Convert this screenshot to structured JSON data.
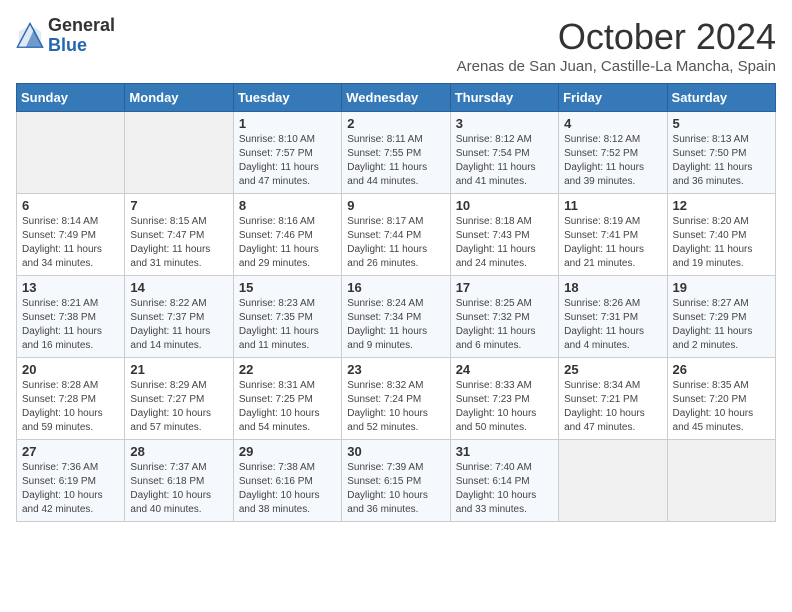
{
  "header": {
    "logo": {
      "general": "General",
      "blue": "Blue"
    },
    "title": "October 2024",
    "subtitle": "Arenas de San Juan, Castille-La Mancha, Spain"
  },
  "weekdays": [
    "Sunday",
    "Monday",
    "Tuesday",
    "Wednesday",
    "Thursday",
    "Friday",
    "Saturday"
  ],
  "weeks": [
    [
      {
        "day": "",
        "info": ""
      },
      {
        "day": "",
        "info": ""
      },
      {
        "day": "1",
        "info": "Sunrise: 8:10 AM\nSunset: 7:57 PM\nDaylight: 11 hours and 47 minutes."
      },
      {
        "day": "2",
        "info": "Sunrise: 8:11 AM\nSunset: 7:55 PM\nDaylight: 11 hours and 44 minutes."
      },
      {
        "day": "3",
        "info": "Sunrise: 8:12 AM\nSunset: 7:54 PM\nDaylight: 11 hours and 41 minutes."
      },
      {
        "day": "4",
        "info": "Sunrise: 8:12 AM\nSunset: 7:52 PM\nDaylight: 11 hours and 39 minutes."
      },
      {
        "day": "5",
        "info": "Sunrise: 8:13 AM\nSunset: 7:50 PM\nDaylight: 11 hours and 36 minutes."
      }
    ],
    [
      {
        "day": "6",
        "info": "Sunrise: 8:14 AM\nSunset: 7:49 PM\nDaylight: 11 hours and 34 minutes."
      },
      {
        "day": "7",
        "info": "Sunrise: 8:15 AM\nSunset: 7:47 PM\nDaylight: 11 hours and 31 minutes."
      },
      {
        "day": "8",
        "info": "Sunrise: 8:16 AM\nSunset: 7:46 PM\nDaylight: 11 hours and 29 minutes."
      },
      {
        "day": "9",
        "info": "Sunrise: 8:17 AM\nSunset: 7:44 PM\nDaylight: 11 hours and 26 minutes."
      },
      {
        "day": "10",
        "info": "Sunrise: 8:18 AM\nSunset: 7:43 PM\nDaylight: 11 hours and 24 minutes."
      },
      {
        "day": "11",
        "info": "Sunrise: 8:19 AM\nSunset: 7:41 PM\nDaylight: 11 hours and 21 minutes."
      },
      {
        "day": "12",
        "info": "Sunrise: 8:20 AM\nSunset: 7:40 PM\nDaylight: 11 hours and 19 minutes."
      }
    ],
    [
      {
        "day": "13",
        "info": "Sunrise: 8:21 AM\nSunset: 7:38 PM\nDaylight: 11 hours and 16 minutes."
      },
      {
        "day": "14",
        "info": "Sunrise: 8:22 AM\nSunset: 7:37 PM\nDaylight: 11 hours and 14 minutes."
      },
      {
        "day": "15",
        "info": "Sunrise: 8:23 AM\nSunset: 7:35 PM\nDaylight: 11 hours and 11 minutes."
      },
      {
        "day": "16",
        "info": "Sunrise: 8:24 AM\nSunset: 7:34 PM\nDaylight: 11 hours and 9 minutes."
      },
      {
        "day": "17",
        "info": "Sunrise: 8:25 AM\nSunset: 7:32 PM\nDaylight: 11 hours and 6 minutes."
      },
      {
        "day": "18",
        "info": "Sunrise: 8:26 AM\nSunset: 7:31 PM\nDaylight: 11 hours and 4 minutes."
      },
      {
        "day": "19",
        "info": "Sunrise: 8:27 AM\nSunset: 7:29 PM\nDaylight: 11 hours and 2 minutes."
      }
    ],
    [
      {
        "day": "20",
        "info": "Sunrise: 8:28 AM\nSunset: 7:28 PM\nDaylight: 10 hours and 59 minutes."
      },
      {
        "day": "21",
        "info": "Sunrise: 8:29 AM\nSunset: 7:27 PM\nDaylight: 10 hours and 57 minutes."
      },
      {
        "day": "22",
        "info": "Sunrise: 8:31 AM\nSunset: 7:25 PM\nDaylight: 10 hours and 54 minutes."
      },
      {
        "day": "23",
        "info": "Sunrise: 8:32 AM\nSunset: 7:24 PM\nDaylight: 10 hours and 52 minutes."
      },
      {
        "day": "24",
        "info": "Sunrise: 8:33 AM\nSunset: 7:23 PM\nDaylight: 10 hours and 50 minutes."
      },
      {
        "day": "25",
        "info": "Sunrise: 8:34 AM\nSunset: 7:21 PM\nDaylight: 10 hours and 47 minutes."
      },
      {
        "day": "26",
        "info": "Sunrise: 8:35 AM\nSunset: 7:20 PM\nDaylight: 10 hours and 45 minutes."
      }
    ],
    [
      {
        "day": "27",
        "info": "Sunrise: 7:36 AM\nSunset: 6:19 PM\nDaylight: 10 hours and 42 minutes."
      },
      {
        "day": "28",
        "info": "Sunrise: 7:37 AM\nSunset: 6:18 PM\nDaylight: 10 hours and 40 minutes."
      },
      {
        "day": "29",
        "info": "Sunrise: 7:38 AM\nSunset: 6:16 PM\nDaylight: 10 hours and 38 minutes."
      },
      {
        "day": "30",
        "info": "Sunrise: 7:39 AM\nSunset: 6:15 PM\nDaylight: 10 hours and 36 minutes."
      },
      {
        "day": "31",
        "info": "Sunrise: 7:40 AM\nSunset: 6:14 PM\nDaylight: 10 hours and 33 minutes."
      },
      {
        "day": "",
        "info": ""
      },
      {
        "day": "",
        "info": ""
      }
    ]
  ]
}
